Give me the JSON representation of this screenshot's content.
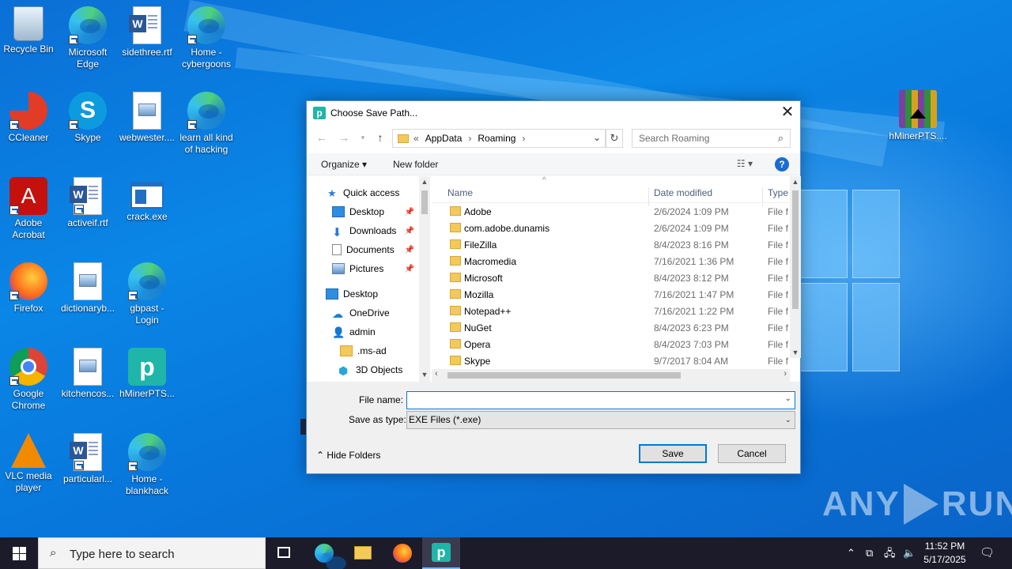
{
  "desktop": {
    "icons": [
      {
        "label": "Recycle Bin"
      },
      {
        "label": "Microsoft Edge"
      },
      {
        "label": "sidethree.rtf"
      },
      {
        "label": "Home - cybergoons"
      },
      {
        "label": "CCleaner"
      },
      {
        "label": "Skype"
      },
      {
        "label": "webwester...."
      },
      {
        "label": "learn all kind of hacking"
      },
      {
        "label": "Adobe Acrobat"
      },
      {
        "label": "activeif.rtf"
      },
      {
        "label": "crack.exe"
      },
      {
        "label": "Firefox"
      },
      {
        "label": "dictionaryb..."
      },
      {
        "label": "gbpast - Login"
      },
      {
        "label": "Google Chrome"
      },
      {
        "label": "kitchencos..."
      },
      {
        "label": "hMinerPTS..."
      },
      {
        "label": "VLC media player"
      },
      {
        "label": "particularl..."
      },
      {
        "label": "Home - blankhack"
      },
      {
        "label": "hMinerPTS...."
      }
    ],
    "watermark": {
      "left": "ANY",
      "right": "RUN"
    }
  },
  "dialog": {
    "title": "Choose Save Path...",
    "address": {
      "prefix": "«",
      "segments": [
        "AppData",
        "Roaming"
      ]
    },
    "search_placeholder": "Search Roaming",
    "toolbar": {
      "organize": "Organize ▾",
      "new_folder": "New folder",
      "help": "?"
    },
    "nav": {
      "quick_access": "Quick access",
      "items": [
        "Desktop",
        "Downloads",
        "Documents",
        "Pictures"
      ],
      "desktop": "Desktop",
      "onedrive": "OneDrive",
      "admin": "admin",
      "ms_ad": ".ms-ad",
      "objects3d": "3D Objects"
    },
    "columns": {
      "name": "Name",
      "date": "Date modified",
      "type": "Type"
    },
    "files": [
      {
        "name": "Adobe",
        "date": "2/6/2024 1:09 PM",
        "type": "File f"
      },
      {
        "name": "com.adobe.dunamis",
        "date": "2/6/2024 1:09 PM",
        "type": "File f"
      },
      {
        "name": "FileZilla",
        "date": "8/4/2023 8:16 PM",
        "type": "File f"
      },
      {
        "name": "Macromedia",
        "date": "7/16/2021 1:36 PM",
        "type": "File f"
      },
      {
        "name": "Microsoft",
        "date": "8/4/2023 8:12 PM",
        "type": "File f"
      },
      {
        "name": "Mozilla",
        "date": "7/16/2021 1:47 PM",
        "type": "File f"
      },
      {
        "name": "Notepad++",
        "date": "7/16/2021 1:22 PM",
        "type": "File f"
      },
      {
        "name": "NuGet",
        "date": "8/4/2023 6:23 PM",
        "type": "File f"
      },
      {
        "name": "Opera",
        "date": "8/4/2023 7:03 PM",
        "type": "File f"
      },
      {
        "name": "Skype",
        "date": "9/7/2017 8:04 AM",
        "type": "File f"
      }
    ],
    "file_name_label": "File name:",
    "file_name_value": "",
    "save_type_label": "Save as type:",
    "save_type_value": "EXE Files (*.exe)",
    "save": "Save",
    "cancel": "Cancel",
    "hide_folders": "Hide Folders"
  },
  "taskbar": {
    "search_placeholder": "Type here to search",
    "time": "11:52 PM",
    "date": "5/17/2025"
  }
}
